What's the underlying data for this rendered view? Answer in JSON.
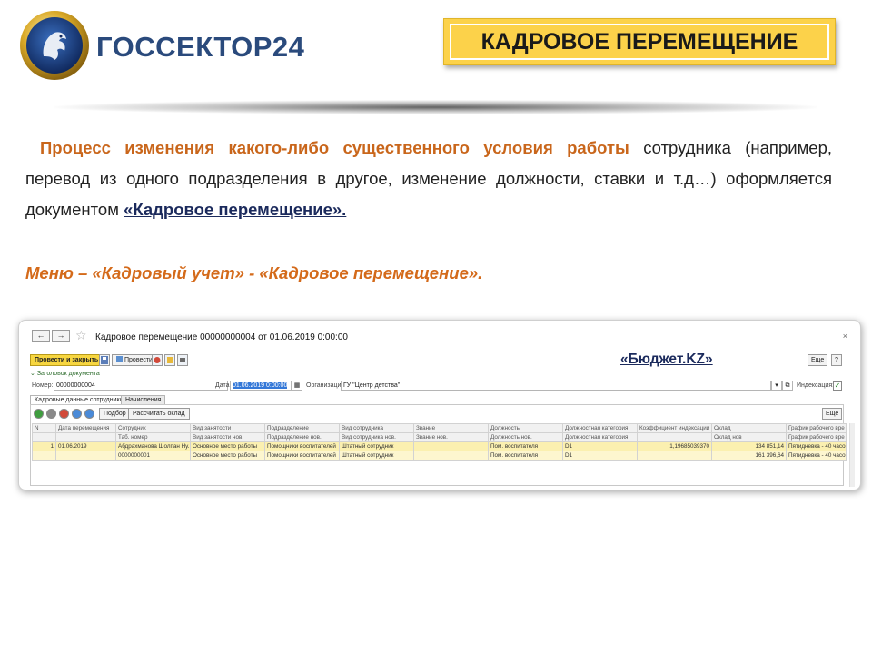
{
  "header": {
    "logo_text": "ГОССЕКТОР24",
    "title": "КАДРОВОЕ ПЕРЕМЕЩЕНИЕ"
  },
  "body": {
    "para_highlight": "Процесс изменения какого-либо существенного условия работы",
    "para_rest": " сотрудника (например, перевод из одного подразделения в другое, изменение должности, ставки и т.д…) оформляется документом ",
    "para_doc": "«Кадровое перемещение».",
    "menu_line": "Меню – «Кадровый учет» - «Кадровое перемещение»."
  },
  "window": {
    "back": "←",
    "forward": "→",
    "title": "Кадровое перемещение 00000000004 от 01.06.2019 0:00:00",
    "close": "×",
    "budget_label": "«Бюджет.KZ»",
    "toolbar": {
      "post_close": "Провести и закрыть",
      "post": "Провести",
      "more": "Еще",
      "help": "?"
    },
    "section_header": "Заголовок документа",
    "fields": {
      "number_label": "Номер:",
      "number_value": "00000000004",
      "date_label": "Дата:",
      "date_value": "01.06.2019 0:00:00",
      "org_label": "Организация:",
      "org_value": "ГУ \"Центр детства\"",
      "index_label": "Индексация:",
      "index_check": "✓"
    },
    "tabs": [
      {
        "label": "Кадровые данные сотрудников"
      },
      {
        "label": "Начисления"
      }
    ],
    "table_toolbar": {
      "select": "Подбор",
      "calc": "Рассчитать оклад",
      "more": "Еще"
    },
    "table": {
      "header1": [
        "N",
        "Дата перемещения",
        "Сотрудник",
        "Вид занятости",
        "Подразделение",
        "Вид сотрудника",
        "Звание",
        "Должность",
        "Должностная категория",
        "Коэффициент индексации",
        "Оклад",
        "График рабочего вре"
      ],
      "header2": [
        "",
        "",
        "Таб. номер",
        "Вид занятости нов.",
        "Подразделение нов.",
        "Вид сотрудника нов.",
        "Звание нов.",
        "Должность нов.",
        "Должностная категория",
        "",
        "Оклад нов",
        "График рабочего вре"
      ],
      "row1": [
        "1",
        "01.06.2019",
        "Абдрахманова Шолпан Ну...",
        "Основное место работы",
        "Помощники воспитателей",
        "Штатный сотрудник",
        "",
        "Пом. воспитателя",
        "D1",
        "1,19685039370",
        "134 851,14",
        "Пятидневка - 40 часов"
      ],
      "row2": [
        "",
        "",
        "0000000001",
        "Основное место работы",
        "Помощники воспитателей",
        "Штатный сотрудник",
        "",
        "Пом. воспитателя",
        "D1",
        "",
        "161 396,64",
        "Пятидневка - 40 часов"
      ]
    }
  }
}
